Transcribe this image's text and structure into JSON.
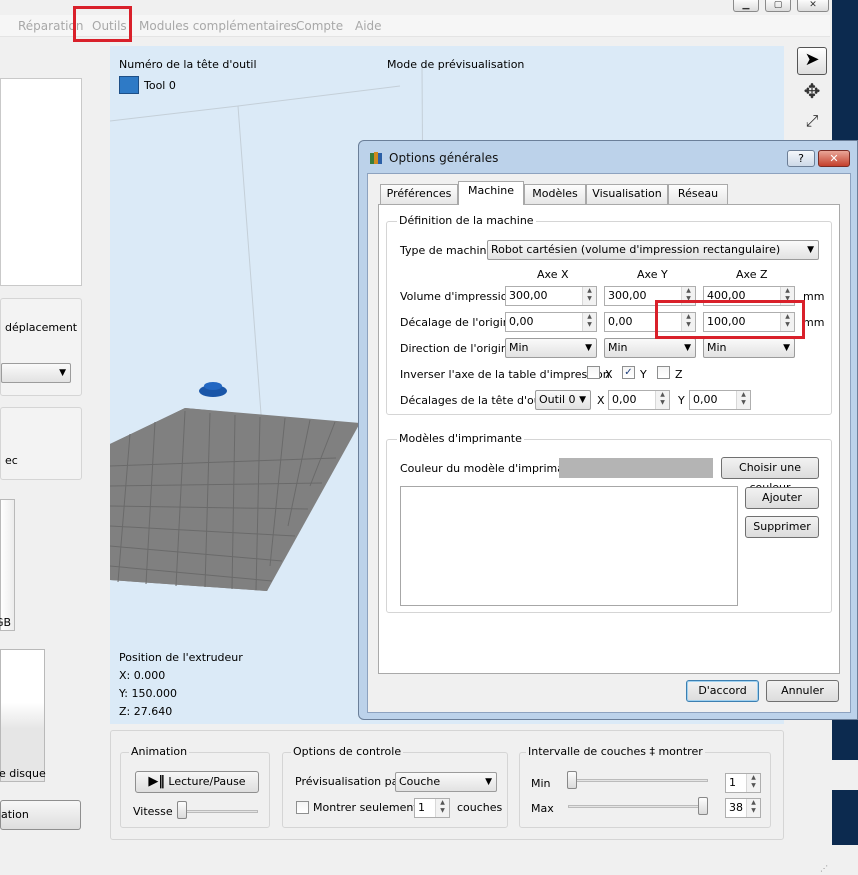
{
  "menu": {
    "items": [
      "Réparation",
      "Outils",
      "Modules complémentaires",
      "Compte",
      "Aide"
    ]
  },
  "window_buttons": {
    "minimize": "▁",
    "maximize": "▢",
    "close": "✕"
  },
  "left_panel": {
    "move_label": "déplacement",
    "partial_label": "ec",
    "size_label": "GB",
    "disk_label": "e disque",
    "bottom_button": "ation"
  },
  "viewport": {
    "tool_header": "Numéro de la tête d'outil",
    "preview_header": "Mode de prévisualisation",
    "tool_name": "Tool 0",
    "tool_color": "#2e7ac6",
    "extruder_title": "Position de l'extrudeur",
    "extruder_x": "X: 0.000",
    "extruder_y": "Y: 150.000",
    "extruder_z": "Z: 27.640"
  },
  "animation": {
    "title": "Animation",
    "play_label": "Lecture/Pause",
    "speed_label": "Vitesse"
  },
  "control": {
    "title": "Options de controle",
    "preview_by_label": "Prévisualisation par",
    "preview_by_value": "Couche",
    "only_show_label": "Montrer seulement",
    "only_show_value": "1",
    "layers_label": "couches"
  },
  "interval": {
    "title": "Intervalle de couches ‡ montrer",
    "min_label": "Min",
    "min_value": "1",
    "max_label": "Max",
    "max_value": "38"
  },
  "dialog": {
    "title": "Options générales",
    "help_button": "?",
    "close_button": "✕",
    "tabs": [
      "Préférences",
      "Machine",
      "Modèles",
      "Visualisation",
      "Réseau"
    ],
    "machine_group": "Définition de la machine",
    "machine_type_label": "Type de machine",
    "machine_type_value": "Robot cartésien (volume d'impression rectangulaire)",
    "axis_x": "Axe X",
    "axis_y": "Axe Y",
    "axis_z": "Axe Z",
    "volume_label": "Volume d'impression",
    "volume_x": "300,00",
    "volume_y": "300,00",
    "volume_z": "400,00",
    "unit": "mm",
    "offset_label": "Décalage de l'origine",
    "offset_x": "0,00",
    "offset_y": "0,00",
    "offset_z": "100,00",
    "direction_label": "Direction de l'origine",
    "direction_x": "Min",
    "direction_y": "Min",
    "direction_z": "Min",
    "invert_label": "Inverser l'axe de la table d'impression",
    "invert_x": "X",
    "invert_y": "Y",
    "invert_z": "Z",
    "check_mark": "✓",
    "tool_offset_label": "Décalages de la tête d'outil",
    "tool_offset_tool": "Outil 0",
    "tool_offset_x_label": "X",
    "tool_offset_x": "0,00",
    "tool_offset_y_label": "Y",
    "tool_offset_y": "0,00",
    "printer_group": "Modèles d'imprimante",
    "printer_color_label": "Couleur du modèle d'imprimante",
    "choose_color_button": "Choisir une couleur",
    "add_button": "Ajouter",
    "remove_button": "Supprimer",
    "ok_button": "D'accord",
    "cancel_button": "Annuler"
  }
}
